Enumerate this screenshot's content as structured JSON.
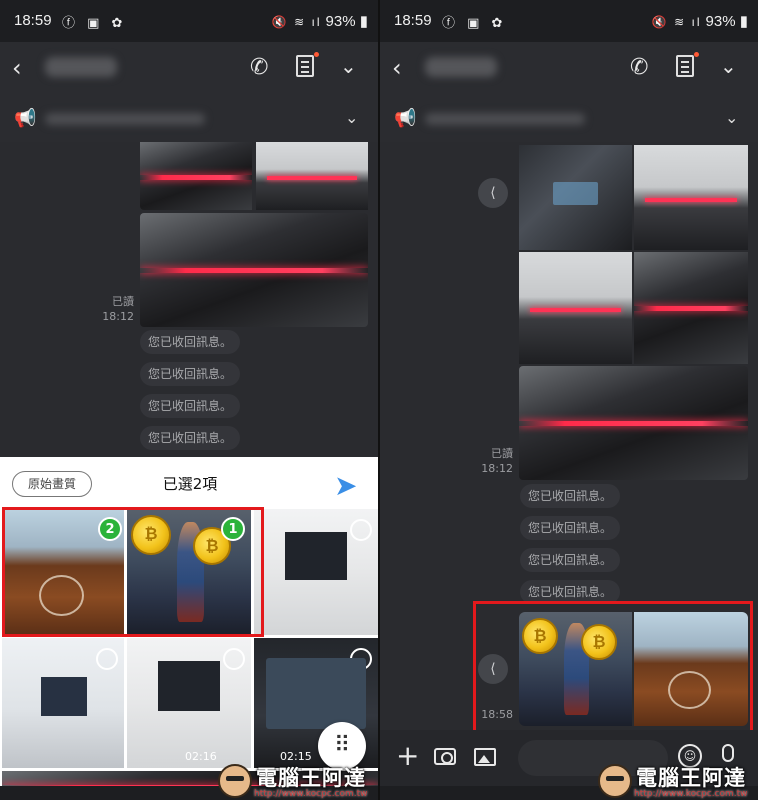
{
  "status_bar": {
    "time": "18:59",
    "battery": "93%"
  },
  "left_panel": {
    "read_label": "已讀",
    "read_time": "18:12",
    "recalled_messages": [
      "您已收回訊息。",
      "您已收回訊息。",
      "您已收回訊息。",
      "您已收回訊息。"
    ],
    "original_quality_label": "原始畫質",
    "selected_count_label": "已選2項",
    "badges": [
      "2",
      "1"
    ],
    "video_durations": [
      "02:16",
      "02:15"
    ]
  },
  "right_panel": {
    "read_label": "已讀",
    "read_time": "18:12",
    "recalled_messages": [
      "您已收回訊息。",
      "您已收回訊息。",
      "您已收回訊息。",
      "您已收回訊息。"
    ],
    "sent_time": "18:58"
  },
  "watermark": {
    "text": "電腦王阿達",
    "url": "http://www.kocpc.com.tw"
  },
  "colors": {
    "highlight_box": "#e3191c",
    "badge_green": "#2bb33a",
    "send_blue": "#3a8ee6",
    "background": "#2a2b2f"
  },
  "icons": [
    "back-arrow-icon",
    "phone-icon",
    "notes-icon",
    "chevron-down-icon",
    "megaphone-icon",
    "send-icon",
    "share-icon",
    "grid-icon",
    "plus-icon",
    "camera-icon",
    "image-icon",
    "emoji-icon",
    "mic-icon"
  ]
}
